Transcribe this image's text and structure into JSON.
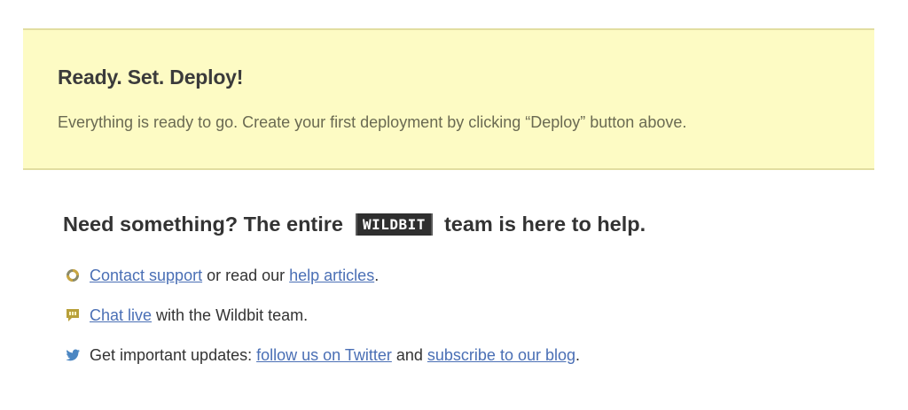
{
  "banner": {
    "title": "Ready. Set. Deploy!",
    "text": "Everything is ready to go. Create your first deployment by clicking “Deploy” button above."
  },
  "help": {
    "heading_prefix": "Need something? The entire",
    "logo_text": "WILDBIT",
    "heading_suffix": "team is here to help.",
    "items": [
      {
        "icon": "support-ring-icon",
        "link1": "Contact support",
        "text1": " or read our ",
        "link2": "help articles",
        "text2": "."
      },
      {
        "icon": "chat-bubble-icon",
        "link1": "Chat live",
        "text1": " with the Wildbit team."
      },
      {
        "icon": "twitter-bird-icon",
        "text0": "Get important updates: ",
        "link1": "follow us on Twitter",
        "text1": " and ",
        "link2": "subscribe to our blog",
        "text2": "."
      }
    ]
  },
  "colors": {
    "banner_bg": "#fdfbc4",
    "link": "#4a6fb5",
    "text": "#333333"
  }
}
